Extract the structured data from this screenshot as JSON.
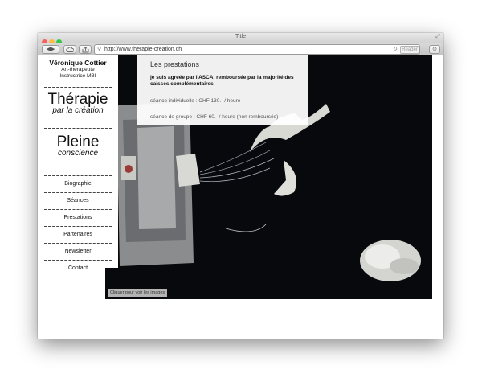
{
  "window": {
    "title": "Title",
    "url": "http://www.therapie-creation.ch",
    "reader_label": "Reader"
  },
  "colors": {
    "close": "#fc605b",
    "minimize": "#fdbc40",
    "zoom": "#34c84a",
    "hero_background": "#07090d"
  },
  "icons": [
    "back-icon",
    "forward-icon",
    "cloud-icon",
    "share-icon",
    "lock-icon",
    "reload-icon",
    "download-icon",
    "resize-icon"
  ],
  "sidebar": {
    "name": "Véronique Cottier",
    "roles": [
      "Art-thérapeute",
      "Instructrice MBI"
    ],
    "brand1": {
      "title": "Thérapie",
      "subtitle": "par la création"
    },
    "brand2": {
      "title": "Pleine",
      "subtitle": "conscience"
    },
    "nav": [
      "Biographie",
      "Séances",
      "Prestations",
      "Partenaires",
      "Newsletter",
      "Contact"
    ]
  },
  "prestations": {
    "title": "Les prestations",
    "intro": "je suis agréée par l'ASCA, remboursée par la majorité des caisses complémentaires",
    "line1": "séance individuelle : CHF 130.- / heure",
    "line2": "séance de groupe : CHF 60.- / heure (non remboursée)"
  },
  "hero": {
    "caption": "Cliquer pour voir les images"
  }
}
